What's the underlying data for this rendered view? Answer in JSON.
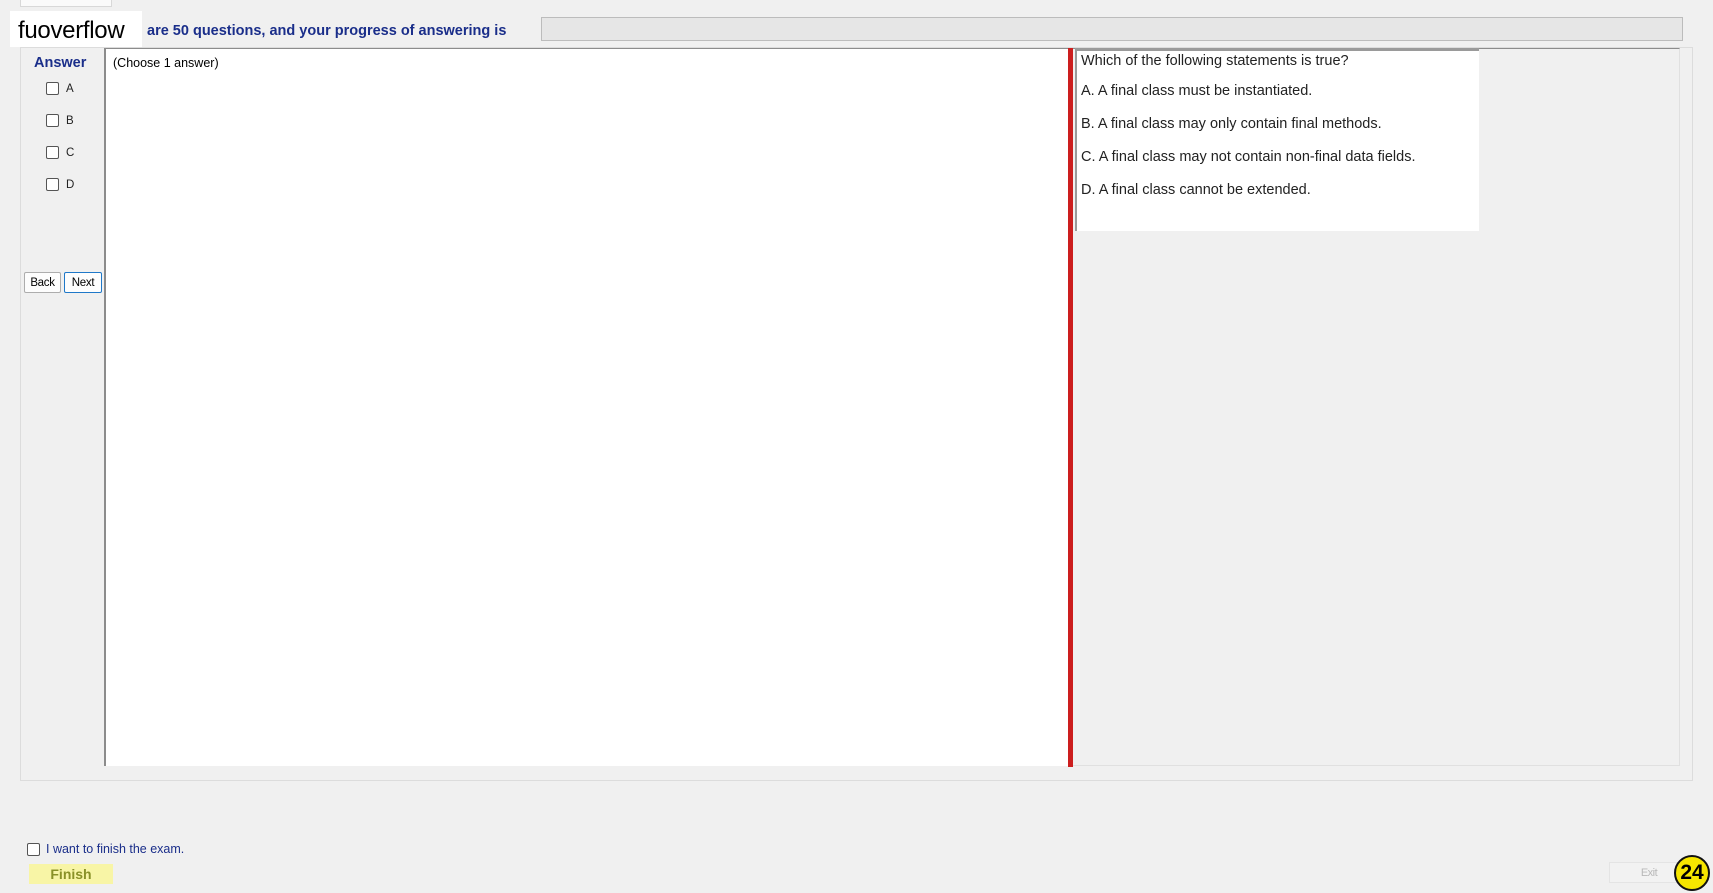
{
  "header": {
    "logo": "fuoverflow",
    "progress_text": "are 50 questions, and your progress of answering is",
    "progress": 0
  },
  "answer_panel": {
    "title": "Answer",
    "options": [
      "A",
      "B",
      "C",
      "D"
    ]
  },
  "navigation": {
    "back_label": "Back",
    "next_label": "Next"
  },
  "instruction": "(Choose 1 answer)",
  "question": {
    "text": "Which of the following statements is true?",
    "options": [
      "A.  A final class must be instantiated.",
      "B.  A final class may only contain final methods.",
      "C.  A final class may not contain non-final data fields.",
      "D.  A final class cannot be extended."
    ]
  },
  "footer": {
    "finish_checkbox_label": "I want to finish the exam.",
    "finish_label": "Finish",
    "exit_label": "Exit",
    "page_number": "24"
  },
  "colors": {
    "accent_blue": "#1a2e8a",
    "divider_red": "#cc1e1e",
    "finish_yellow": "#f8f5a6",
    "badge_yellow": "#f6e600"
  }
}
